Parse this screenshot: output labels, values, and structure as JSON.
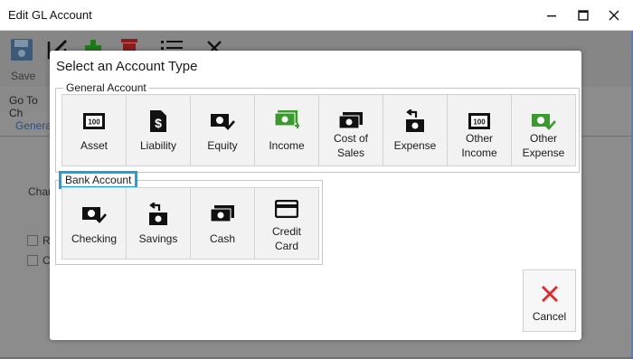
{
  "window": {
    "title": "Edit GL Account",
    "minimize": "minimize",
    "maximize": "maximize",
    "close": "close"
  },
  "background": {
    "save_label": "Save",
    "goto_label": "Go To Ch",
    "tab_label": "Genera",
    "field_label": "Char",
    "check1_label": "R",
    "check2_label": "C"
  },
  "dialog": {
    "title": "Select an Account Type",
    "general_group": {
      "legend": "General Account",
      "items": [
        {
          "label": "Asset",
          "icon": "asset-icon"
        },
        {
          "label": "Liability",
          "icon": "liability-icon"
        },
        {
          "label": "Equity",
          "icon": "equity-icon"
        },
        {
          "label": "Income",
          "icon": "income-icon"
        },
        {
          "label": "Cost of Sales",
          "line1": "Cost of",
          "line2": "Sales",
          "icon": "cost-of-sales-icon"
        },
        {
          "label": "Expense",
          "icon": "expense-icon"
        },
        {
          "label": "Other Income",
          "line1": "Other",
          "line2": "Income",
          "icon": "other-income-icon"
        },
        {
          "label": "Other Expense",
          "line1": "Other",
          "line2": "Expense",
          "icon": "other-expense-icon"
        }
      ]
    },
    "bank_group": {
      "legend": "Bank Account",
      "items": [
        {
          "label": "Checking",
          "icon": "checking-icon"
        },
        {
          "label": "Savings",
          "icon": "savings-icon"
        },
        {
          "label": "Cash",
          "icon": "cash-icon"
        },
        {
          "label": "Credit Card",
          "line1": "Credit",
          "line2": "Card",
          "icon": "credit-card-icon"
        }
      ]
    },
    "cancel_label": "Cancel"
  },
  "colors": {
    "green": "#3a9a2e",
    "highlight": "#1ea0d9",
    "cancel_red": "#e0282d",
    "delete_red": "#c62828"
  }
}
